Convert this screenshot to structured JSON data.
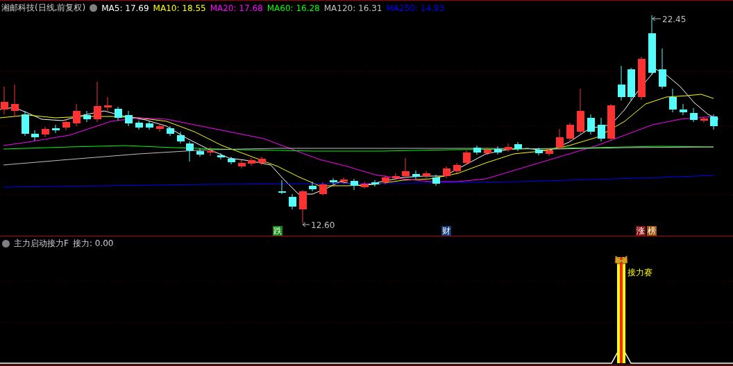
{
  "title": "湘邮科技(日线,前复权)",
  "moving_averages": [
    {
      "name": "MA5:",
      "value": "17.69",
      "color": "#ffffff"
    },
    {
      "name": "MA10:",
      "value": "18.55",
      "color": "#ffff00"
    },
    {
      "name": "MA20:",
      "value": "17.68",
      "color": "#ff00ff"
    },
    {
      "name": "MA60:",
      "value": "16.28",
      "color": "#00ff00"
    },
    {
      "name": "MA120:",
      "value": "16.31",
      "color": "#c0c0c0"
    },
    {
      "name": "MA250:",
      "value": "14.93",
      "color": "#0000ff"
    }
  ],
  "price_chart": {
    "high_label": "22.45",
    "low_label": "12.60",
    "markers": [
      {
        "text": "跌",
        "color": "#138a13"
      },
      {
        "text": "财",
        "color": "#0f3a78"
      },
      {
        "text": "涨",
        "color": "#8a1010"
      },
      {
        "text": "榜",
        "color": "#a0520a"
      }
    ]
  },
  "indicator": {
    "name": "主力启动接力F",
    "reading": "接力: 0.00",
    "signal_label": "接力赛"
  }
}
